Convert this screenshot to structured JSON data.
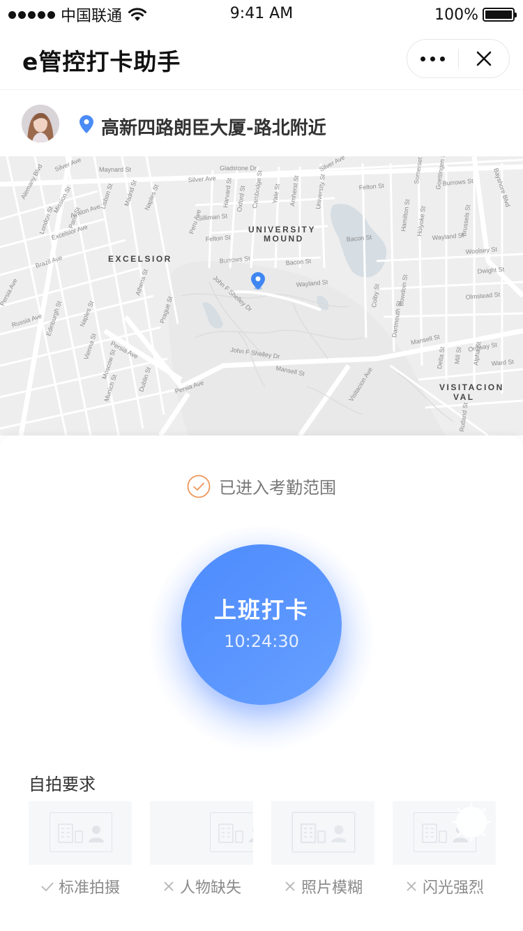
{
  "status_bar": {
    "carrier": "中国联通",
    "time": "9:41 AM",
    "battery": "100%",
    "battery_level": 1.0
  },
  "nav": {
    "title": "e管控打卡助手",
    "more_icon": "more-dots-icon",
    "close_icon": "close-icon"
  },
  "location": {
    "avatar_icon": "user-avatar",
    "pin_icon": "location-pin-icon",
    "address": "高新四路朗臣大厦-路北附近"
  },
  "map": {
    "labels": {
      "university": "UNIVERSITY",
      "mound": "MOUND",
      "excelsior": "EXCELSIOR",
      "visitacion": "VISITACION",
      "val": "VAL",
      "silver_ave": "Silver Ave",
      "mansell_st": "Mansell St",
      "persia_ave": "Persia Ave",
      "naples_st": "Naples St",
      "bacon_st": "Bacon St",
      "felton_st": "Felton St",
      "burrows_st": "Burrows St",
      "wayland_st": "Wayland St",
      "john_f_shelley_dr": "John F Shelley Dr",
      "alemany_blvd": "Alemany Blvd",
      "mission_st": "Mission St",
      "bayshore_blvd": "Bayshore Blvd",
      "visitacion_ave": "Visitacion Ave",
      "olmstead_st": "Olmstead St",
      "woolsey_st": "Woolsey St",
      "dwight_st": "Dwight St",
      "ward_st": "Ward St",
      "ordway_st": "Ordway St",
      "gladstone_dr": "Gladstone Dr",
      "maynard_st": "Maynard St",
      "london_st": "London St",
      "paris_st": "Paris St",
      "lisbon_st": "Lisbon St",
      "madrid_st": "Madrid St",
      "edinburgh_st": "Edinburgh St",
      "vienna_st": "Vienna St",
      "athens_st": "Athens St",
      "moscow_st": "Moscow St",
      "munich_st": "Munich St",
      "prague_st": "Prague St",
      "dublin_st": "Dublin St",
      "avalon_ave": "Avalon Ave",
      "excelsior_ave": "Excelsior Ave",
      "brazil_ave": "Brazil Ave",
      "russia_ave": "Russia Ave",
      "peru_ave": "Peru Ave",
      "silliman_st": "Silliman St",
      "cambridge_st": "Cambridge St",
      "oxford_st": "Oxford St",
      "harvard_st": "Harvard St",
      "yale_st": "Yale St",
      "amherst_st": "Amherst St",
      "university_st": "University St",
      "colby_st": "Colby St",
      "bowdoin_st": "Bowdoin St",
      "dartmouth_st": "Dartmouth St",
      "holyoke_st": "Holyoke St",
      "hamilton_st": "Hamilton St",
      "brussels_st": "Brussels St",
      "goettingen_st": "Goettingen St",
      "somerset_st": "Somerset St",
      "delta_st": "Delta St",
      "mill_st": "Mill St",
      "alpha_st": "Alpha St",
      "rutland_st": "Rutland St"
    },
    "pin_icon": "map-marker-icon",
    "locate_icon": "locate-icon"
  },
  "status": {
    "icon": "check-circle-icon",
    "text": "已进入考勤范围",
    "accent_color": "#f0955a"
  },
  "punch": {
    "label": "上班打卡",
    "time": "10:24:30",
    "color": "#5592ff"
  },
  "selfie": {
    "title": "自拍要求",
    "samples": [
      {
        "caption": "标准拍摄",
        "icon": "check-icon",
        "image": "id-card-standard"
      },
      {
        "caption": "人物缺失",
        "icon": "cross-icon",
        "image": "id-card-person-missing"
      },
      {
        "caption": "照片模糊",
        "icon": "cross-icon",
        "image": "id-card-blurry"
      },
      {
        "caption": "闪光强烈",
        "icon": "cross-icon",
        "image": "id-card-flash"
      }
    ]
  }
}
